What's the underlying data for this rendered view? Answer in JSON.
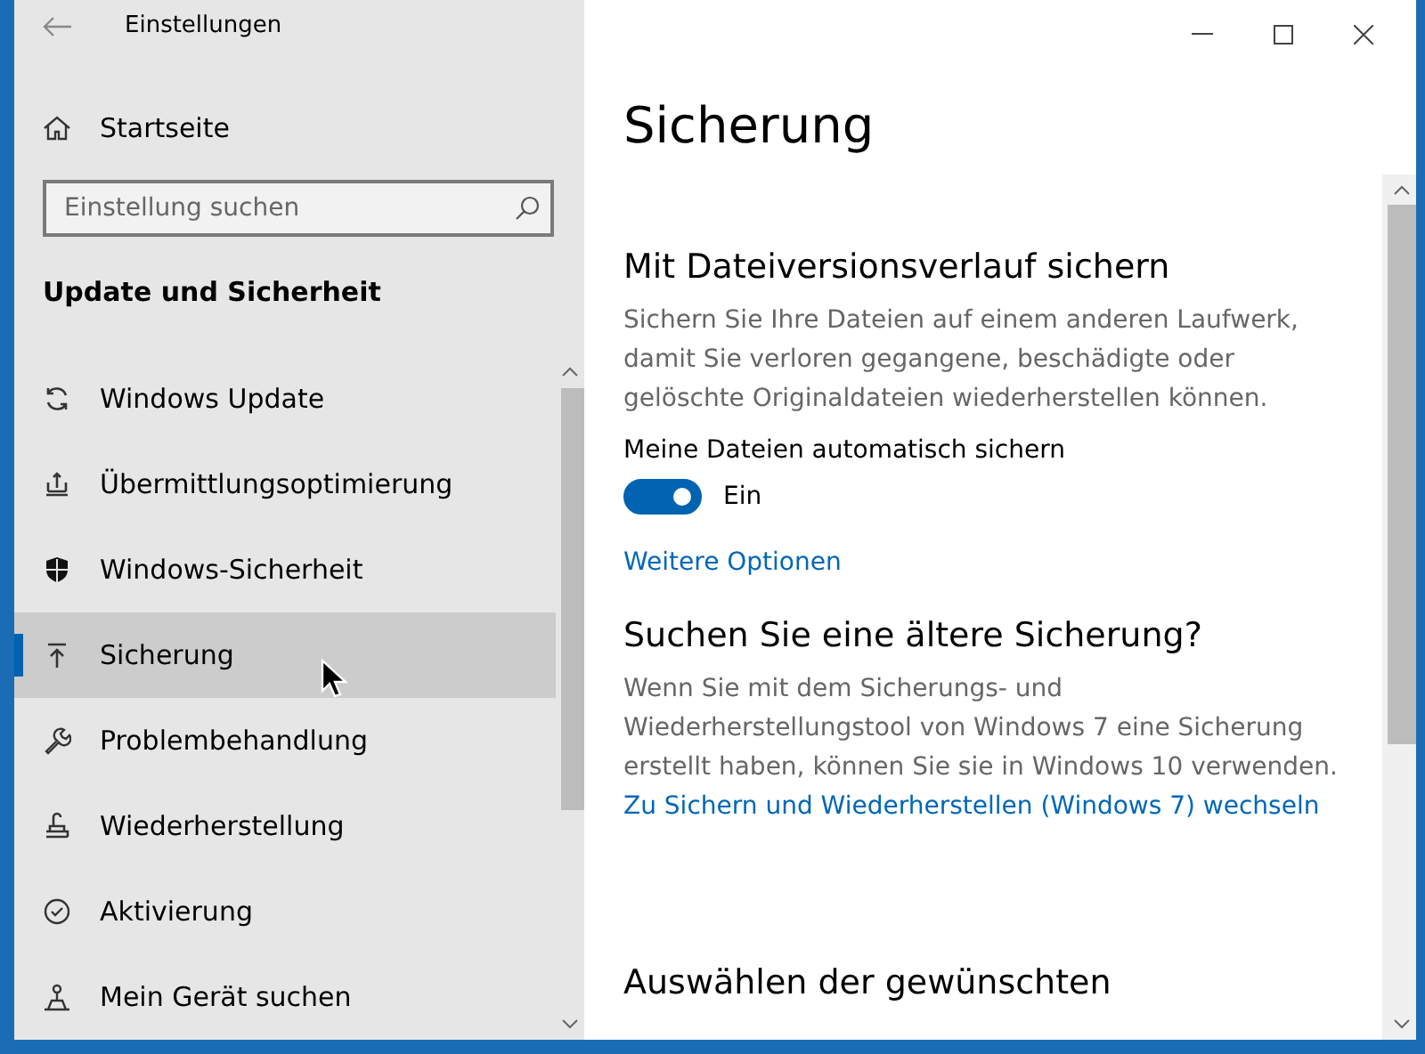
{
  "window": {
    "title": "Einstellungen"
  },
  "sidebar": {
    "home": "Startseite",
    "search": {
      "placeholder": "Einstellung suchen"
    },
    "section": "Update und Sicherheit",
    "items": [
      {
        "label": "Windows Update",
        "selected": false
      },
      {
        "label": "Übermittlungsoptimierung",
        "selected": false
      },
      {
        "label": "Windows-Sicherheit",
        "selected": false
      },
      {
        "label": "Sicherung",
        "selected": true
      },
      {
        "label": "Problembehandlung",
        "selected": false
      },
      {
        "label": "Wiederherstellung",
        "selected": false
      },
      {
        "label": "Aktivierung",
        "selected": false
      },
      {
        "label": "Mein Gerät suchen",
        "selected": false
      }
    ]
  },
  "content": {
    "title": "Sicherung",
    "file_history": {
      "heading": "Mit Dateiversionsverlauf sichern",
      "description": "Sichern Sie Ihre Dateien auf einem anderen Laufwerk, damit Sie verloren gegangene, beschädigte oder gelöschte Originaldateien wiederherstellen können.",
      "toggle_label": "Meine Dateien automatisch sichern",
      "toggle": {
        "on": true,
        "text": "Ein"
      },
      "link": "Weitere Optionen"
    },
    "older_backup": {
      "heading": "Suchen Sie eine ältere Sicherung?",
      "description": "Wenn Sie mit dem Sicherungs- und Wiederherstellungstool von Windows 7 eine Sicherung erstellt haben, können Sie sie in Windows 10 verwenden.",
      "link": "Zu Sichern und Wiederherstellen (Windows 7) wechseln"
    },
    "next_heading": "Auswählen der gewünschten"
  }
}
